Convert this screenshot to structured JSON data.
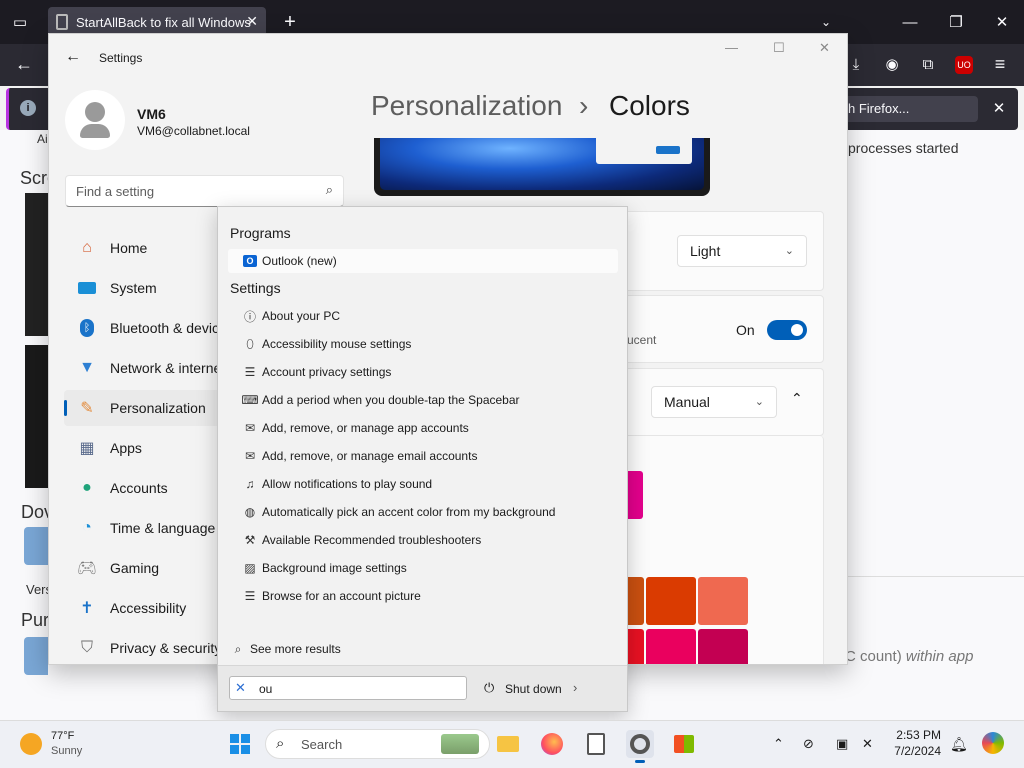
{
  "firefox": {
    "tab_title": "StartAllBack to fix all Windows",
    "notification_text": "h Firefox...",
    "background_fragments": {
      "screenshots_heading": "Scre",
      "processes_text": "processes started",
      "download_heading": "Dov",
      "version_fragment": "Vers",
      "purchase_fragment": "Pur",
      "count_text": "C count)",
      "within_app_text": "within app",
      "ai_fragment": "Ai"
    }
  },
  "settings": {
    "title": "Settings",
    "user": {
      "name": "VM6",
      "email": "VM6@collabnet.local"
    },
    "search_placeholder": "Find a setting",
    "breadcrumb": {
      "parent": "Personalization",
      "separator": "›",
      "current": "Colors"
    },
    "nav": [
      {
        "label": "Home",
        "icon": "home-icon",
        "color": "#d6643a"
      },
      {
        "label": "System",
        "icon": "system-icon",
        "color": "#1a8fd6"
      },
      {
        "label": "Bluetooth & devices",
        "icon": "bluetooth-icon",
        "color": "#1a73c9"
      },
      {
        "label": "Network & internet",
        "icon": "network-icon",
        "color": "#2d7fd3"
      },
      {
        "label": "Personalization",
        "icon": "brush-icon",
        "color": "#e38b3c"
      },
      {
        "label": "Apps",
        "icon": "apps-icon",
        "color": "#5a6b8c"
      },
      {
        "label": "Accounts",
        "icon": "accounts-icon",
        "color": "#1fa37a"
      },
      {
        "label": "Time & language",
        "icon": "time-language-icon",
        "color": "#1a8fd6"
      },
      {
        "label": "Gaming",
        "icon": "gaming-icon",
        "color": "#7a7a7a"
      },
      {
        "label": "Accessibility",
        "icon": "accessibility-icon",
        "color": "#1a73c9"
      },
      {
        "label": "Privacy & security",
        "icon": "shield-icon",
        "color": "#6d6d6d"
      }
    ],
    "mode_value": "Light",
    "transparency": {
      "sub_text": "ucent",
      "state_label": "On"
    },
    "accent_value": "Manual",
    "swatches": [
      "#d13438",
      "#e81123",
      "#ea005e",
      "#da3b01",
      "#ef6950",
      "#e74856",
      "#e3008c",
      "#bf0077",
      "#ca5010"
    ]
  },
  "flyout": {
    "programs_header": "Programs",
    "programs": [
      {
        "label": "Outlook (new)",
        "icon": "outlook-icon"
      }
    ],
    "settings_header": "Settings",
    "settings_items": [
      {
        "label": "About your PC",
        "icon": "info-icon"
      },
      {
        "label": "Accessibility mouse settings",
        "icon": "mouse-icon"
      },
      {
        "label": "Account privacy settings",
        "icon": "account-list-icon"
      },
      {
        "label": "Add a period when you double-tap the Spacebar",
        "icon": "keyboard-icon"
      },
      {
        "label": "Add, remove, or manage app accounts",
        "icon": "mail-icon"
      },
      {
        "label": "Add, remove, or manage email accounts",
        "icon": "mail-icon"
      },
      {
        "label": "Allow notifications to play sound",
        "icon": "bell-icon"
      },
      {
        "label": "Automatically pick an accent color from my background",
        "icon": "palette-icon"
      },
      {
        "label": "Available Recommended troubleshooters",
        "icon": "wrench-icon"
      },
      {
        "label": "Background image settings",
        "icon": "image-icon"
      },
      {
        "label": "Browse for an account picture",
        "icon": "account-list-icon"
      }
    ],
    "see_more": "See more results",
    "search_value": "ou",
    "shutdown_label": "Shut down"
  },
  "taskbar": {
    "weather": {
      "temp": "77°F",
      "condition": "Sunny"
    },
    "search_placeholder": "Search",
    "time": "2:53 PM",
    "date": "7/2/2024"
  }
}
